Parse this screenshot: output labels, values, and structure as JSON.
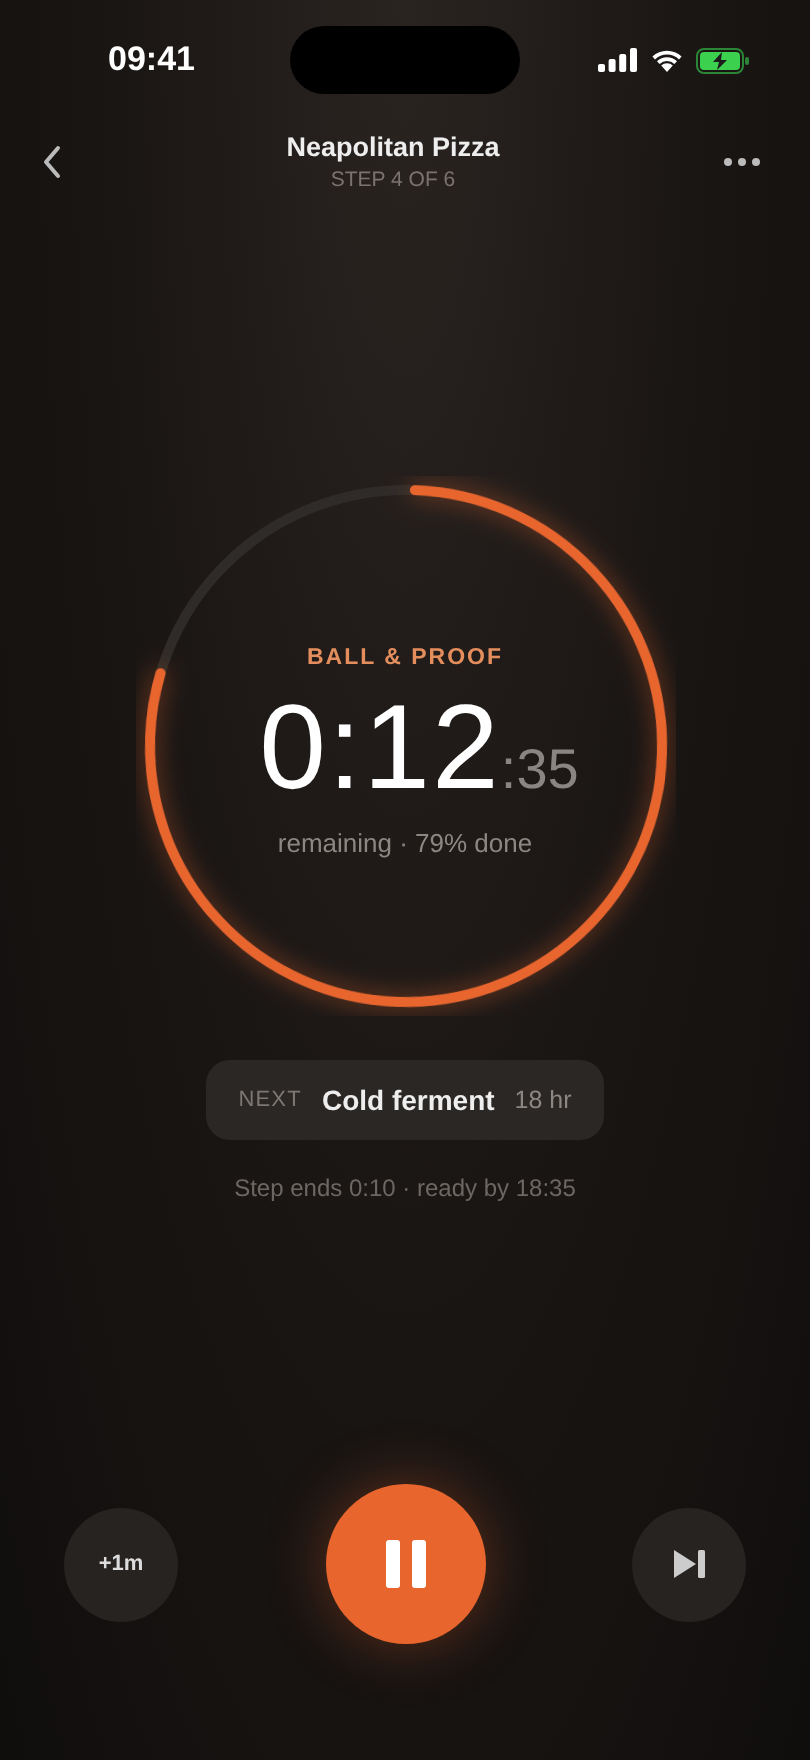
{
  "status_bar": {
    "time": "09:41"
  },
  "header": {
    "title": "Neapolitan Pizza",
    "subtitle": "STEP 4 OF 6"
  },
  "timer": {
    "label": "BALL & PROOF",
    "main": "0:12",
    "seconds": ":35",
    "caption": "remaining · 79% done",
    "level": 0.79
  },
  "next": {
    "tag": "NEXT",
    "name": "Cold ferment",
    "duration": "18 hr"
  },
  "note": "Step ends 0:10 · ready by 18:35",
  "controls": {
    "add_label": "+1m",
    "playing": true
  }
}
